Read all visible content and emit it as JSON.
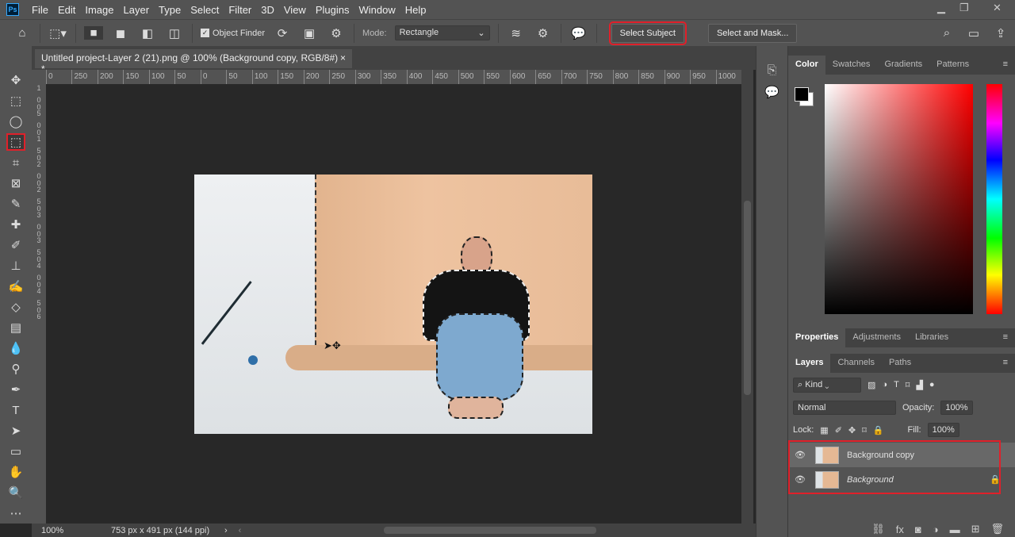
{
  "app": {
    "logo": "Ps",
    "menu": [
      "File",
      "Edit",
      "Image",
      "Layer",
      "Type",
      "Select",
      "Filter",
      "3D",
      "View",
      "Plugins",
      "Window",
      "Help"
    ]
  },
  "options": {
    "object_finder_label": "Object Finder",
    "object_finder_checked": true,
    "mode_label": "Mode:",
    "mode_value": "Rectangle",
    "select_subject": "Select Subject",
    "select_and_mask": "Select and Mask..."
  },
  "document": {
    "tab_title": "Untitled project-Layer 2 (21).png @ 100% (Background copy, RGB/8#) *",
    "close": "×"
  },
  "ruler": {
    "h": [
      "0",
      "250",
      "200",
      "150",
      "100",
      "50",
      "0",
      "50",
      "100",
      "150",
      "200",
      "250",
      "300",
      "350",
      "400",
      "450",
      "500",
      "550",
      "600",
      "650",
      "700",
      "750",
      "800",
      "850",
      "900",
      "950",
      "1000"
    ],
    "v": [
      "1",
      "0",
      "0",
      "5",
      "0",
      "0",
      "1",
      "5",
      "0",
      "2",
      "0",
      "0",
      "2",
      "5",
      "0",
      "3",
      "0",
      "0",
      "3",
      "5",
      "0",
      "4",
      "0",
      "0",
      "4",
      "5",
      "0",
      "6"
    ]
  },
  "status": {
    "zoom": "100%",
    "info": "753 px x 491 px (144 ppi)"
  },
  "color_panel": {
    "tabs": [
      "Color",
      "Swatches",
      "Gradients",
      "Patterns"
    ],
    "active": 0,
    "fg": "#000000",
    "bg": "#ffffff",
    "hue": "#ff0000"
  },
  "properties_panel": {
    "tabs": [
      "Properties",
      "Adjustments",
      "Libraries"
    ],
    "active": 0
  },
  "layers_panel": {
    "tabs": [
      "Layers",
      "Channels",
      "Paths"
    ],
    "active": 0,
    "filter": "Kind",
    "blend_mode": "Normal",
    "opacity_label": "Opacity:",
    "opacity": "100%",
    "lock_label": "Lock:",
    "fill_label": "Fill:",
    "fill": "100%",
    "layers": [
      {
        "name": "Background copy",
        "visible": true,
        "selected": true,
        "locked": false
      },
      {
        "name": "Background",
        "visible": true,
        "selected": false,
        "locked": true
      }
    ]
  },
  "colors": {
    "highlight": "#e0202a"
  }
}
